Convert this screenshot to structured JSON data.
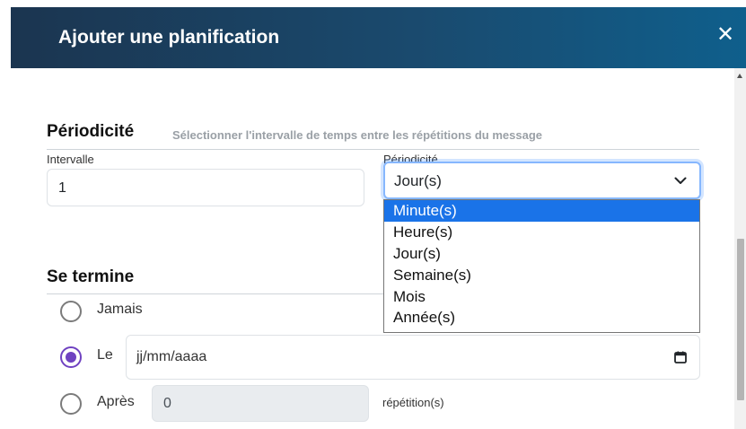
{
  "modal": {
    "title": "Ajouter une planification",
    "close_symbol": "✕"
  },
  "periodicity": {
    "section_title": "Périodicité",
    "hint": "Sélectionner l'intervalle de temps entre les répétitions du message",
    "interval_label": "Intervalle",
    "interval_value": "1",
    "select_label": "Périodicité",
    "select_value": "Jour(s)",
    "options": [
      "Minute(s)",
      "Heure(s)",
      "Jour(s)",
      "Semaine(s)",
      "Mois",
      "Année(s)"
    ],
    "highlighted_option": "Minute(s)"
  },
  "ends": {
    "section_title": "Se termine",
    "never_label": "Jamais",
    "on_label": "Le",
    "date_placeholder": "jj/mm/aaaa",
    "after_label": "Après",
    "after_value": "0",
    "after_suffix": "répétition(s)",
    "selected": "Le"
  },
  "colors": {
    "header_start": "#1b3550",
    "header_end": "#0f5f8c",
    "radio_accent": "#6f42c1",
    "option_highlight": "#1a73e8",
    "focus_border": "#86b7fe"
  },
  "icons": {
    "close": "close-icon",
    "chevron": "chevron-down-icon",
    "calendar": "calendar-icon"
  }
}
